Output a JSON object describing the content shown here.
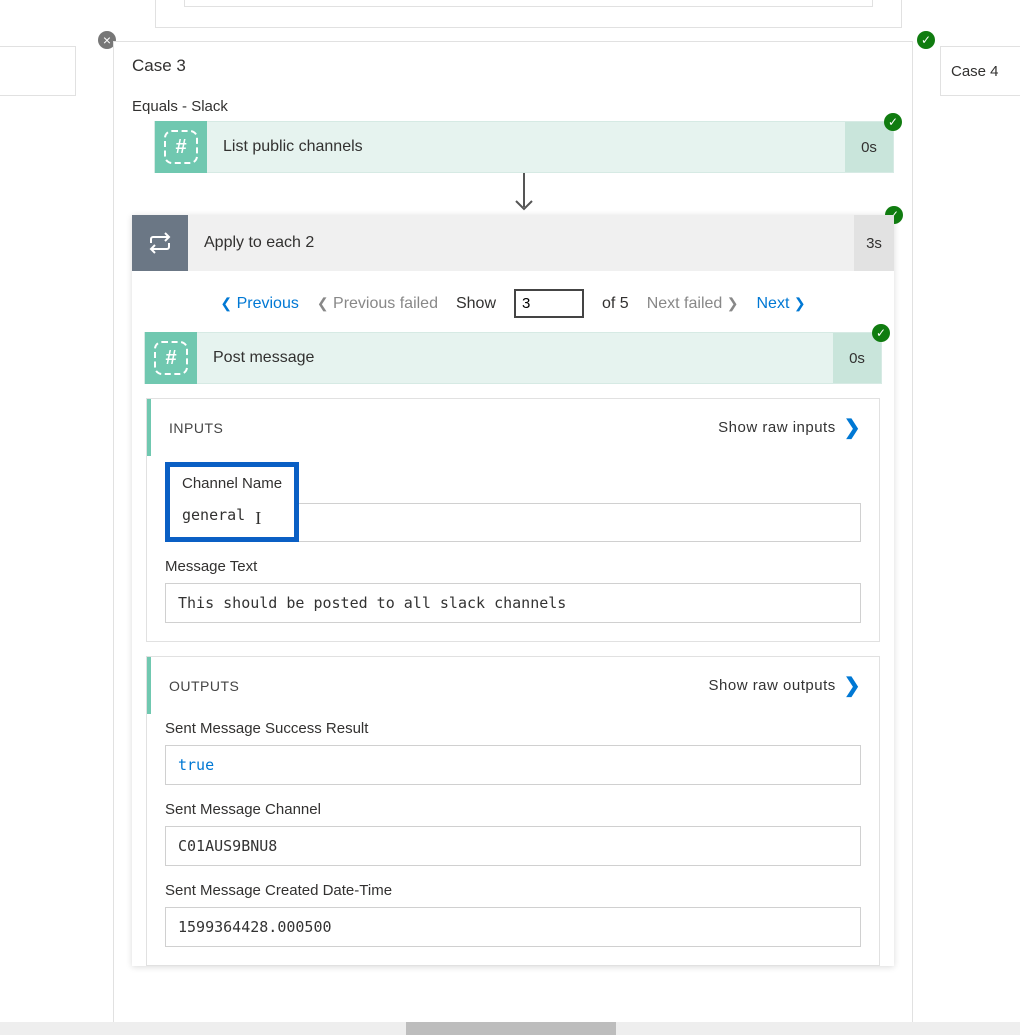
{
  "case_title": "Case 3",
  "case4_title": "Case 4",
  "subtitle": "Equals - Slack",
  "close_glyph": "×",
  "check_glyph": "✓",
  "list_channels": {
    "label": "List public channels",
    "duration": "0s",
    "hash": "#"
  },
  "loop": {
    "label": "Apply to each 2",
    "duration": "3s"
  },
  "pager": {
    "previous": "Previous",
    "previous_failed": "Previous failed",
    "show_label": "Show",
    "current": "3",
    "of_label": "of 5",
    "next_failed": "Next failed",
    "next": "Next"
  },
  "post_message": {
    "label": "Post message",
    "duration": "0s",
    "hash": "#"
  },
  "inputs": {
    "header": "INPUTS",
    "raw_link": "Show raw inputs",
    "channel_name_label": "Channel Name",
    "channel_name_value": "general",
    "message_text_label": "Message Text",
    "message_text_value": "This should be posted to all slack channels"
  },
  "outputs": {
    "header": "OUTPUTS",
    "raw_link": "Show raw outputs",
    "success_label": "Sent Message Success Result",
    "success_value": "true",
    "channel_label": "Sent Message Channel",
    "channel_value": "C01AUS9BNU8",
    "created_label": "Sent Message Created Date-Time",
    "created_value": "1599364428.000500"
  }
}
